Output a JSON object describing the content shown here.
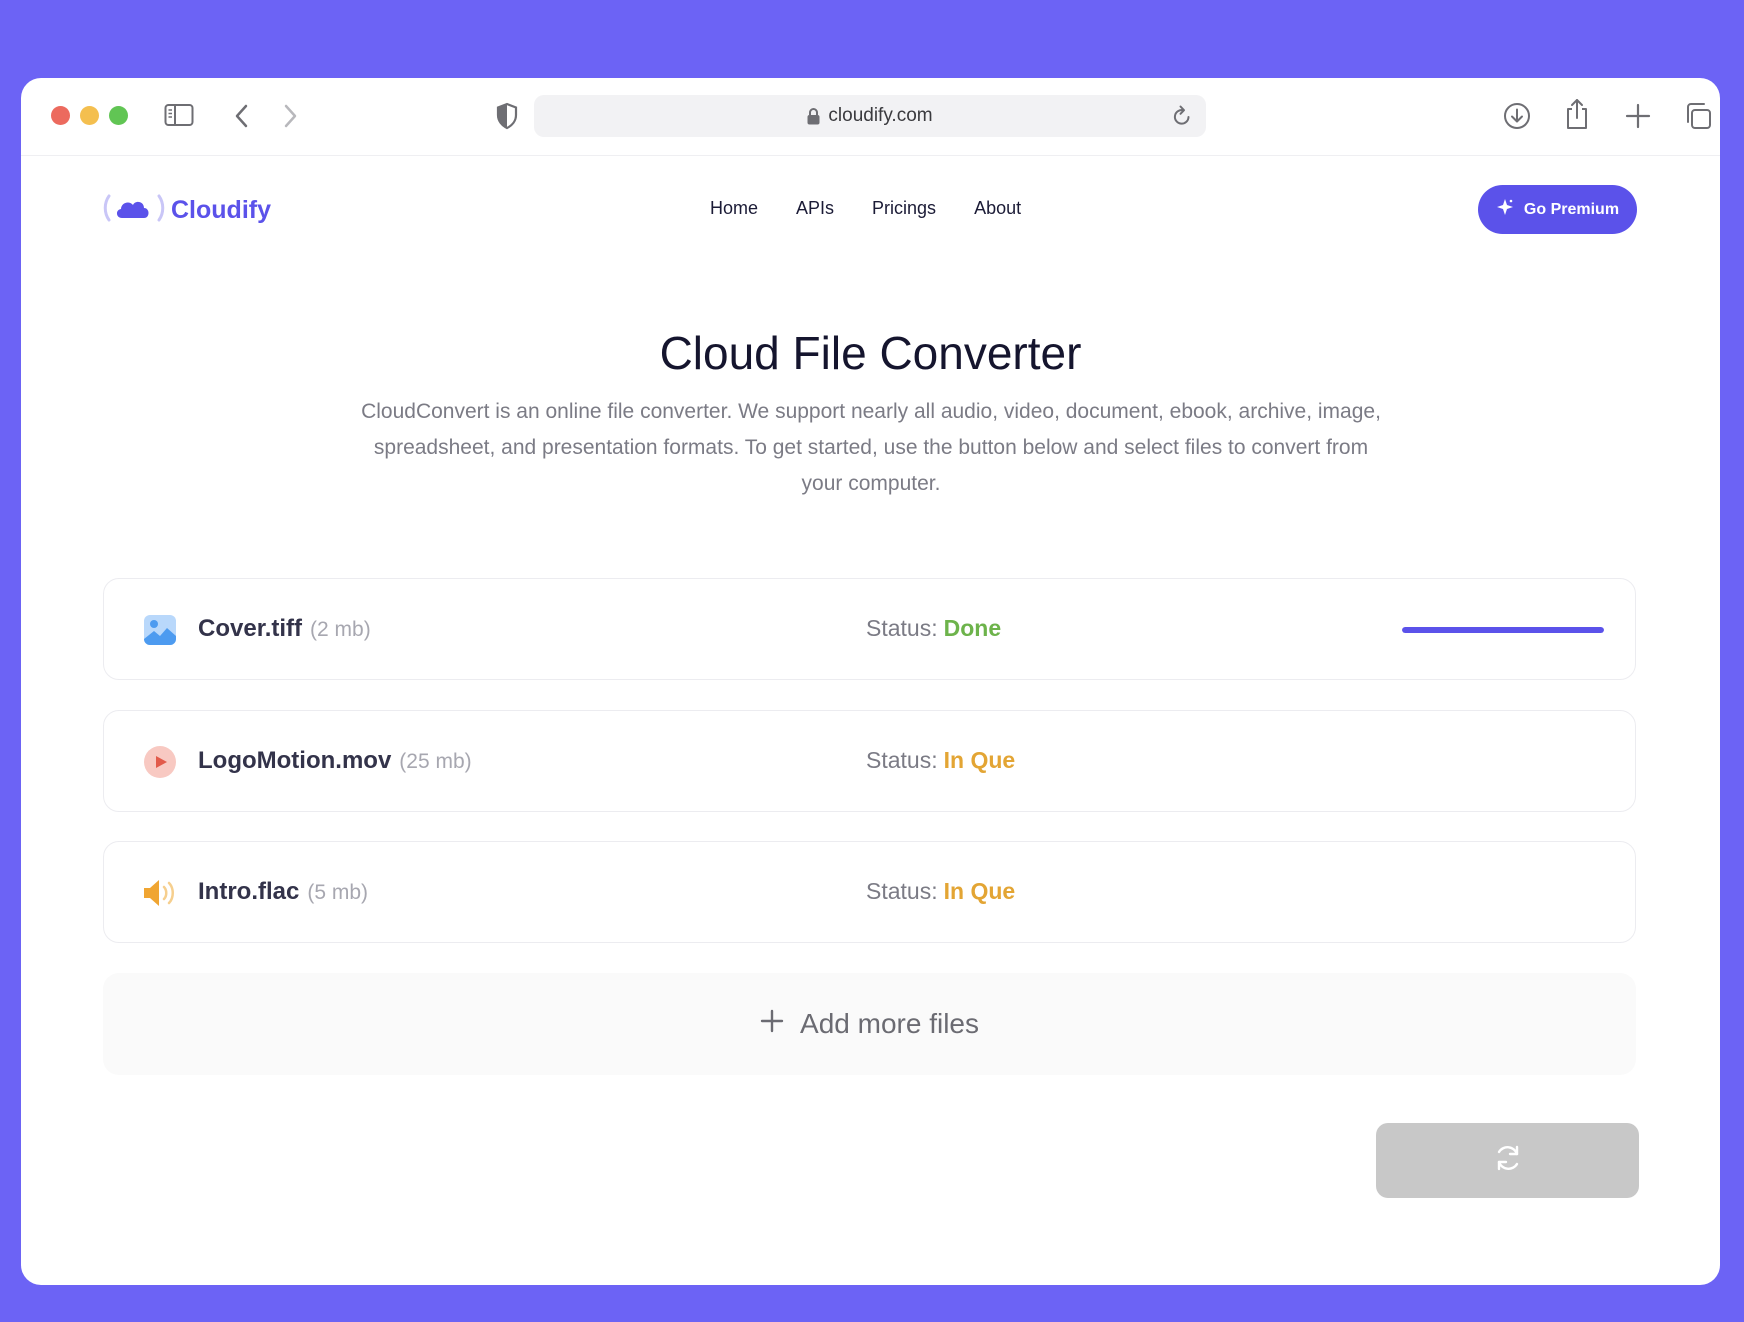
{
  "browser": {
    "url": "cloudify.com"
  },
  "brand": {
    "name": "Cloudify"
  },
  "nav": {
    "items": [
      {
        "label": "Home"
      },
      {
        "label": "APIs"
      },
      {
        "label": "Pricings"
      },
      {
        "label": "About"
      }
    ],
    "premium_label": "Go Premium"
  },
  "hero": {
    "title": "Cloud File Converter",
    "description": "CloudConvert is an online file converter. We support nearly all audio, video, document, ebook, archive, image, spreadsheet, and presentation formats. To get started, use the button below and select files to convert from your computer."
  },
  "files": [
    {
      "name": "Cover.tiff",
      "size": "(2 mb)",
      "status_label": "Status:",
      "status": "Done",
      "icon": "image-file-icon",
      "progress": 1.0
    },
    {
      "name": "LogoMotion.mov",
      "size": "(25 mb)",
      "status_label": "Status:",
      "status": "In Que",
      "icon": "video-file-icon"
    },
    {
      "name": "Intro.flac",
      "size": "(5 mb)",
      "status_label": "Status:",
      "status": "In Que",
      "icon": "audio-file-icon"
    }
  ],
  "add_more_label": "Add more files",
  "colors": {
    "background": "#6c63f5",
    "accent": "#5b52ea",
    "status_done": "#6db34b",
    "status_queue": "#e3a534",
    "convert_disabled": "#c8c8c8"
  }
}
